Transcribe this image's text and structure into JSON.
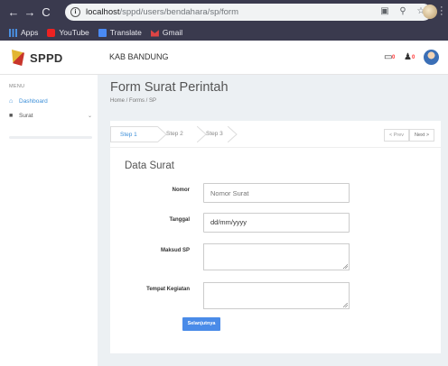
{
  "browser": {
    "url_host": "localhost",
    "url_path": "/sppd/users/bendahara/sp/form",
    "bookmarks": [
      "Apps",
      "YouTube",
      "Translate",
      "Gmail"
    ]
  },
  "header": {
    "logo_text": "SPPD",
    "title": "KAB BANDUNG",
    "notif_count": "0",
    "alert_count": "0"
  },
  "sidebar": {
    "menu_label": "MENU",
    "items": [
      {
        "label": "Dashboard",
        "icon": "home-icon"
      },
      {
        "label": "Surat",
        "icon": "folder-icon"
      }
    ]
  },
  "page": {
    "title": "Form Surat Perintah",
    "breadcrumb": "Home / Forms / SP"
  },
  "wizard": {
    "steps": [
      "Step 1",
      "Step 2",
      "Step 3"
    ],
    "prev_label": "< Prev",
    "next_label": "Next >"
  },
  "form": {
    "section_title": "Data Surat",
    "fields": [
      {
        "label": "Nomor",
        "value": "",
        "placeholder": "Nomor Surat"
      },
      {
        "label": "Tanggal",
        "value": "dd/mm/yyyy",
        "placeholder": ""
      },
      {
        "label": "Maksud SP",
        "value": "",
        "placeholder": ""
      },
      {
        "label": "Tempat Kegiatan",
        "value": "",
        "placeholder": ""
      }
    ],
    "submit_label": "Selanjutnya"
  },
  "colors": {
    "accent": "#3d8fd8",
    "button": "#4a8be8",
    "chrome": "#3a3a4e"
  }
}
